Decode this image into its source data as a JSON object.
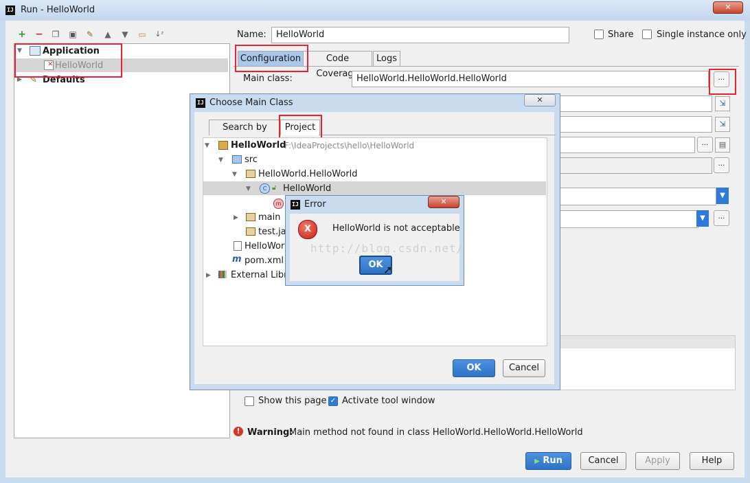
{
  "window": {
    "title": "Run - HelloWorld"
  },
  "toolbar": {
    "icons": [
      "add-icon",
      "remove-icon",
      "copy-icon",
      "save-icon",
      "wrench-icon",
      "arrow-up-icon",
      "arrow-down-icon",
      "folder-icon",
      "sort-icon"
    ]
  },
  "tree": {
    "items": [
      {
        "label": "Application"
      },
      {
        "label": "HelloWorld"
      },
      {
        "label": "Defaults"
      }
    ]
  },
  "config": {
    "name_label": "Name:",
    "name_value": "HelloWorld",
    "share_label": "Share",
    "single_instance_label": "Single instance only",
    "tabs": [
      {
        "label": "Configuration"
      },
      {
        "label": "Code Coverage"
      },
      {
        "label": "Logs"
      }
    ],
    "main_class_label": "Main class:",
    "main_class_value": "HelloWorld.HelloWorld.HelloWorld",
    "browse_label": "..."
  },
  "before_launch": {
    "show_page_label": "Show this page",
    "show_page_checked": false,
    "activate_tool_label": "Activate tool window",
    "activate_tool_checked": true
  },
  "warning": {
    "prefix": "Warning:",
    "message": "Main method not found in class HelloWorld.HelloWorld.HelloWorld"
  },
  "buttons": {
    "run": "Run",
    "cancel": "Cancel",
    "apply": "Apply",
    "help": "Help"
  },
  "chooser": {
    "title": "Choose Main Class",
    "tabs": [
      {
        "label": "Search by Name"
      },
      {
        "label": "Project"
      }
    ],
    "nodes": [
      {
        "label": "HelloWorld",
        "path": "F:\\IdeaProjects\\hello\\HelloWorld"
      },
      {
        "label": "src"
      },
      {
        "label": "HelloWorld.HelloWorld"
      },
      {
        "label": "HelloWorld"
      },
      {
        "label": "main"
      },
      {
        "label": "test.java"
      },
      {
        "label": "HelloWorld.iml"
      },
      {
        "label": "pom.xml"
      },
      {
        "label": "External Libraries"
      }
    ],
    "ok": "OK",
    "cancel": "Cancel"
  },
  "error_dialog": {
    "title": "Error",
    "message": "HelloWorld is not acceptable",
    "ok": "OK",
    "watermark": "http://blog.csdn.net/"
  },
  "colors": {
    "accent": "#2f7ad6",
    "highlight": "#e8232f",
    "selection": "#a9c7ea"
  }
}
